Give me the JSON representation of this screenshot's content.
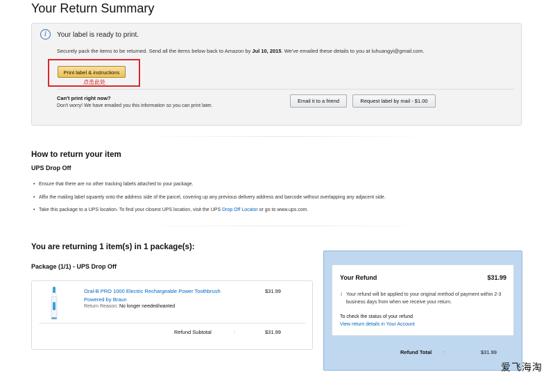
{
  "page": {
    "title": "Your Return Summary"
  },
  "info": {
    "ready": "Your label is ready to print.",
    "instructions_prefix": "Securely pack the items to be returned. Send all the items below back to Amazon by ",
    "deadline": "Jul 10, 2015",
    "instructions_suffix": ". We've emailed these details to you at luhuangyi@gmail.com.",
    "print_button": "Print label & instructions",
    "annotation": "点击此处",
    "cant_print_title": "Can't print right now?",
    "cant_print_text": "Don't worry! We have emailed you this information so you can print later.",
    "email_button": "Email it to a friend",
    "request_button": "Request label by mail - $1.00"
  },
  "how": {
    "title": "How to return your item",
    "method": "UPS Drop Off",
    "steps": [
      "Ensure that there are no other tracking labels attached to your package.",
      "Affix the mailing label squarely onto the address side of the parcel, covering up any previous delivery address and barcode without overlapping any adjacent side."
    ],
    "step3_prefix": "Take this package to a UPS location. To find your closest UPS location, visit the UPS ",
    "step3_link": "Drop Off Locator",
    "step3_suffix": " or go to www.ups.com."
  },
  "returning": {
    "title": "You are returning 1 item(s) in 1 package(s):",
    "package_title": "Package (1/1) - UPS Drop Off",
    "item": {
      "name": "Oral-B PRO 1000 Electric Rechargeable Power Toothbrush",
      "brand": "Powered by Braun",
      "reason_label": "Return Reason:",
      "reason_value": "No longer needed/wanted",
      "price": "$31.99"
    },
    "subtotal_label": "Refund Subtotal",
    "colon": ":",
    "subtotal_value": "$31.99"
  },
  "refund": {
    "title": "Your Refund",
    "amount": "$31.99",
    "info_icon": "i",
    "info": "Your refund will be applied to your original method of payment within 2-3 business days from when we receive your return.",
    "check_status": "To check the status of your refund",
    "details_link": "View return details in Your Account",
    "total_label": "Refund Total",
    "colon": ":",
    "total_value": "$31.99"
  },
  "watermark": "爱飞海淘",
  "icons": {
    "info": "info-icon",
    "product": "toothbrush-image"
  },
  "colors": {
    "accent_button": "#f0c14b",
    "link": "#0066c0",
    "annotation": "#d9262c",
    "refund_panel": "#bfd8f0"
  }
}
